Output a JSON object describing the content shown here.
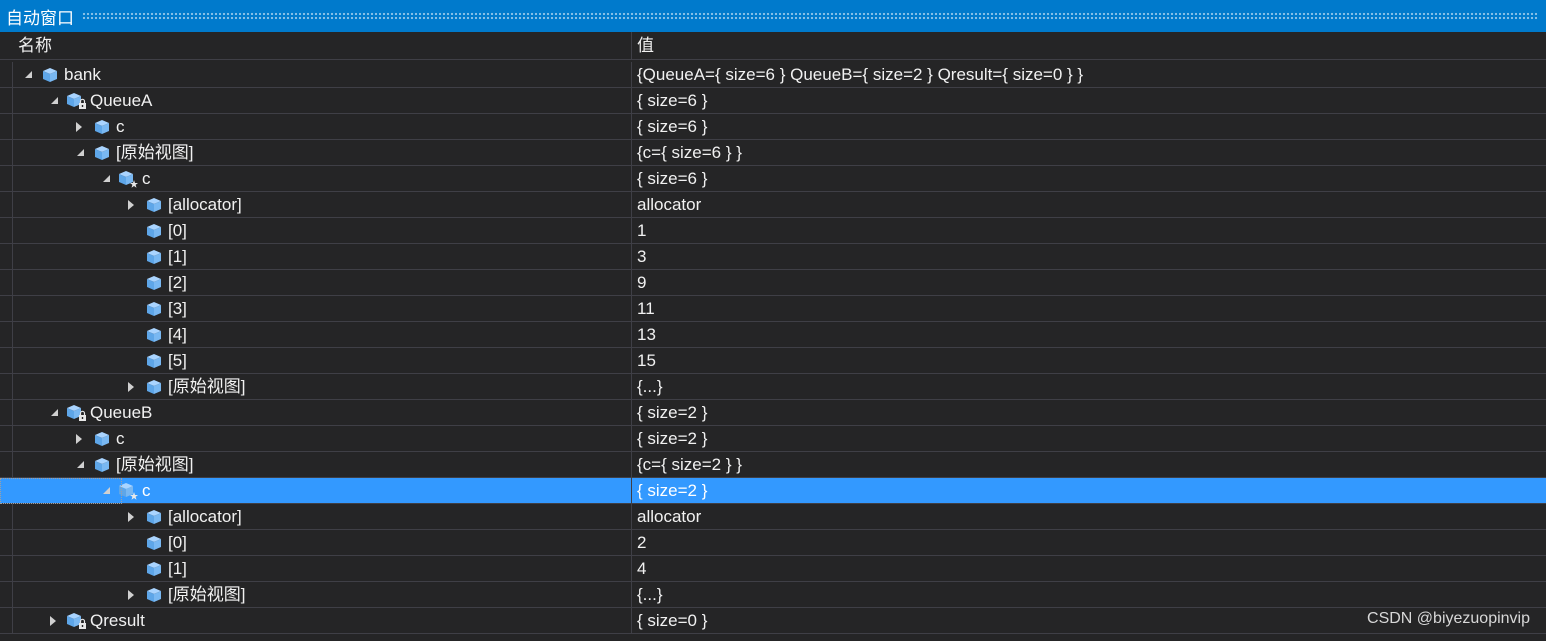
{
  "window": {
    "title": "自动窗口"
  },
  "columns": {
    "name": "名称",
    "value": "值"
  },
  "rows": [
    {
      "depth": 0,
      "expander": "expanded",
      "icon": "object-field-icon",
      "name": "bank",
      "value": "{QueueA={ size=6 } QueueB={ size=2 } Qresult={ size=0 } }"
    },
    {
      "depth": 1,
      "expander": "expanded",
      "icon": "private-field-icon",
      "name": "QueueA",
      "value": "{ size=6 }"
    },
    {
      "depth": 2,
      "expander": "collapsed",
      "icon": "object-field-icon",
      "name": "c",
      "value": "{ size=6 }"
    },
    {
      "depth": 2,
      "expander": "expanded",
      "icon": "object-field-icon",
      "name": "[原始视图]",
      "value": "{c={ size=6 } }"
    },
    {
      "depth": 3,
      "expander": "expanded",
      "icon": "protected-field-icon",
      "name": "c",
      "value": "{ size=6 }"
    },
    {
      "depth": 4,
      "expander": "collapsed",
      "icon": "object-field-icon",
      "name": "[allocator]",
      "value": "allocator"
    },
    {
      "depth": 4,
      "expander": "none",
      "icon": "object-field-icon",
      "name": "[0]",
      "value": "1"
    },
    {
      "depth": 4,
      "expander": "none",
      "icon": "object-field-icon",
      "name": "[1]",
      "value": "3"
    },
    {
      "depth": 4,
      "expander": "none",
      "icon": "object-field-icon",
      "name": "[2]",
      "value": "9"
    },
    {
      "depth": 4,
      "expander": "none",
      "icon": "object-field-icon",
      "name": "[3]",
      "value": "11"
    },
    {
      "depth": 4,
      "expander": "none",
      "icon": "object-field-icon",
      "name": "[4]",
      "value": "13"
    },
    {
      "depth": 4,
      "expander": "none",
      "icon": "object-field-icon",
      "name": "[5]",
      "value": "15"
    },
    {
      "depth": 4,
      "expander": "collapsed",
      "icon": "object-field-icon",
      "name": "[原始视图]",
      "value": "{...}"
    },
    {
      "depth": 1,
      "expander": "expanded",
      "icon": "private-field-icon",
      "name": "QueueB",
      "value": "{ size=2 }"
    },
    {
      "depth": 2,
      "expander": "collapsed",
      "icon": "object-field-icon",
      "name": "c",
      "value": "{ size=2 }"
    },
    {
      "depth": 2,
      "expander": "expanded",
      "icon": "object-field-icon",
      "name": "[原始视图]",
      "value": "{c={ size=2 } }"
    },
    {
      "depth": 3,
      "expander": "expanded",
      "icon": "protected-field-icon",
      "name": "c",
      "value": "{ size=2 }",
      "selected": true
    },
    {
      "depth": 4,
      "expander": "collapsed",
      "icon": "object-field-icon",
      "name": "[allocator]",
      "value": "allocator"
    },
    {
      "depth": 4,
      "expander": "none",
      "icon": "object-field-icon",
      "name": "[0]",
      "value": "2"
    },
    {
      "depth": 4,
      "expander": "none",
      "icon": "object-field-icon",
      "name": "[1]",
      "value": "4"
    },
    {
      "depth": 4,
      "expander": "collapsed",
      "icon": "object-field-icon",
      "name": "[原始视图]",
      "value": "{...}"
    },
    {
      "depth": 1,
      "expander": "collapsed",
      "icon": "private-field-icon",
      "name": "Qresult",
      "value": "{ size=0 }"
    }
  ],
  "colors": {
    "titlebar": "#007acc",
    "selection": "#3399ff",
    "icon_fill": "#79b8f2",
    "background": "#252526"
  },
  "watermark": "CSDN @biyezuopinvip"
}
